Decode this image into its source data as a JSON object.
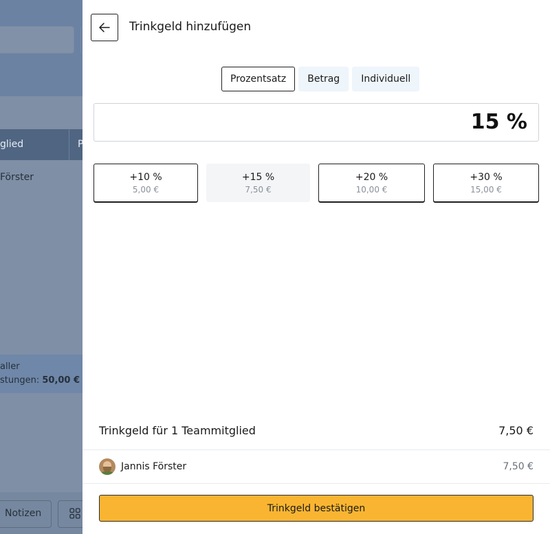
{
  "background": {
    "table_header_col1": "glied",
    "table_header_col2": "P",
    "row_name": "Förster",
    "summary_line1": "aller",
    "summary_line2_label": "stungen:",
    "summary_line2_value": "50,00 €",
    "notes_button": "Notizen"
  },
  "drawer": {
    "title": "Trinkgeld hinzufügen",
    "tabs": [
      "Prozentsatz",
      "Betrag",
      "Individuell"
    ],
    "active_tab": "Prozentsatz",
    "amount_display": "15 %",
    "presets": [
      {
        "percent": "+10 %",
        "amount": "5,00 €"
      },
      {
        "percent": "+15 %",
        "amount": "7,50 €"
      },
      {
        "percent": "+20 %",
        "amount": "10,00 €"
      },
      {
        "percent": "+30 %",
        "amount": "15,00 €"
      }
    ],
    "selected_preset": "+15 %",
    "summary_label": "Trinkgeld für 1 Teammitglied",
    "summary_value": "7,50 €",
    "member": {
      "name": "Jannis Förster",
      "amount": "7,50 €"
    },
    "confirm_label": "Trinkgeld bestätigen"
  },
  "colors": {
    "accent": "#f9b531",
    "tab_bg": "#eef5fb",
    "overlay": "#7f8fa6"
  }
}
